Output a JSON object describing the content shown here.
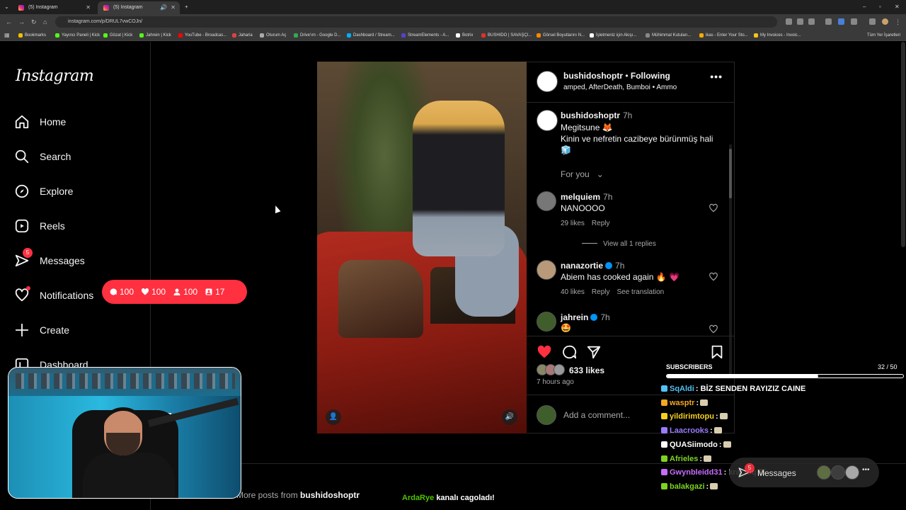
{
  "browser": {
    "tabs": [
      {
        "title": "(5) Instagram",
        "active": false
      },
      {
        "title": "(5) Instagram",
        "active": true
      }
    ],
    "url": "instagram.com/p/DRUL7vwCOJn/",
    "bookmarks": [
      {
        "label": "Bookmarks",
        "color": "#f0c000"
      },
      {
        "label": "Yayıncı Paneli | Kick",
        "color": "#53fc18"
      },
      {
        "label": "Gözat | Kick",
        "color": "#53fc18"
      },
      {
        "label": "Jahrein | Kick",
        "color": "#53fc18"
      },
      {
        "label": "YouTube - Broadcas...",
        "color": "#ff0000"
      },
      {
        "label": "Jaharia",
        "color": "#e04040"
      },
      {
        "label": "Oturum Aç",
        "color": "#aaaaaa"
      },
      {
        "label": "Drive'ım - Google D...",
        "color": "#34a853"
      },
      {
        "label": "Dashboard / Stream...",
        "color": "#00b0ff"
      },
      {
        "label": "StreamElements - A...",
        "color": "#5b3fd1"
      },
      {
        "label": "Botrix",
        "color": "#ffffff"
      },
      {
        "label": "BUSHIDO | SAVAŞÇI...",
        "color": "#e03030"
      },
      {
        "label": "Görsel Boyutlarını N...",
        "color": "#ff8800"
      },
      {
        "label": "İşletmeniz için Akışı...",
        "color": "#ffffff"
      },
      {
        "label": "Mühimmat Kutuları...",
        "color": "#888888"
      },
      {
        "label": "ikas - Enter Your Sto...",
        "color": "#ffaa00"
      },
      {
        "label": "My Invoices - Invoic...",
        "color": "#f5c518"
      }
    ],
    "all_bookmarks": "Tüm Yer İşaretleri"
  },
  "sidebar": {
    "logo": "Instagram",
    "items": [
      {
        "label": "Home",
        "icon": "home-icon"
      },
      {
        "label": "Search",
        "icon": "search-icon"
      },
      {
        "label": "Explore",
        "icon": "compass-icon"
      },
      {
        "label": "Reels",
        "icon": "reels-icon"
      },
      {
        "label": "Messages",
        "icon": "messenger-icon",
        "badge": "5"
      },
      {
        "label": "Notifications",
        "icon": "heart-icon"
      },
      {
        "label": "Create",
        "icon": "plus-icon"
      },
      {
        "label": "Dashboard",
        "icon": "dashboard-icon"
      }
    ],
    "notif_pill": {
      "comments": "100",
      "likes": "100",
      "follows": "100",
      "tags": "17"
    }
  },
  "post": {
    "header": {
      "username": "bushidoshoptr",
      "following": "Following",
      "audio": "amped, AfterDeath, Bumboi • Ammo"
    },
    "caption": {
      "username": "bushidoshoptr",
      "time": "7h",
      "line1": "Megitsune 🦊",
      "line2": "Kinin ve nefretin cazibeye bürünmüş hali",
      "line3": "🧊"
    },
    "for_you": "For you",
    "comments": [
      {
        "username": "melquiem",
        "time": "7h",
        "text": "NANOOOO",
        "likes": "29 likes",
        "reply": "Reply",
        "view_replies": "View all 1 replies",
        "verified": false
      },
      {
        "username": "nanazortie",
        "time": "7h",
        "text": "Abiem has cooked again 🔥 💗",
        "likes": "40 likes",
        "reply": "Reply",
        "translate": "See translation",
        "verified": true
      },
      {
        "username": "jahrein",
        "time": "7h",
        "text": "🤩",
        "verified": true
      }
    ],
    "likes": "633 likes",
    "ago": "7 hours ago",
    "add_comment": "Add a comment...",
    "liked": true
  },
  "more_posts": {
    "prefix": "More posts from",
    "username": "bushidoshoptr"
  },
  "overlay": {
    "subscribers_label": "SUBSCRIBERS",
    "subscribers_count": "32 / 50",
    "subscribers_progress": 0.64,
    "chat": [
      {
        "user": "SqAldi",
        "color": "#4fc3f7",
        "text": ": BİZ SENDEN RAYIZIZ CAINE"
      },
      {
        "user": "wasptr",
        "color": "#f5a623",
        "text": ":"
      },
      {
        "user": "yildirimtopu",
        "color": "#f5d020",
        "text": ":"
      },
      {
        "user": "Laacrooks",
        "color": "#9b7bff",
        "text": ":"
      },
      {
        "user": "QUASiimodo",
        "color": "#ffffff",
        "text": ":"
      },
      {
        "user": "Afrieles",
        "color": "#7ed321",
        "text": ":"
      },
      {
        "user": "Gwynbleidd31",
        "color": "#c86bff",
        "text": ": kral mq"
      },
      {
        "user": "balakgazi",
        "color": "#7ed321",
        "text": ":"
      }
    ],
    "messages_label": "Messages",
    "messages_badge": "5",
    "banner_user": "ArdaRye",
    "banner_text": "kanalı cagoladı!"
  }
}
